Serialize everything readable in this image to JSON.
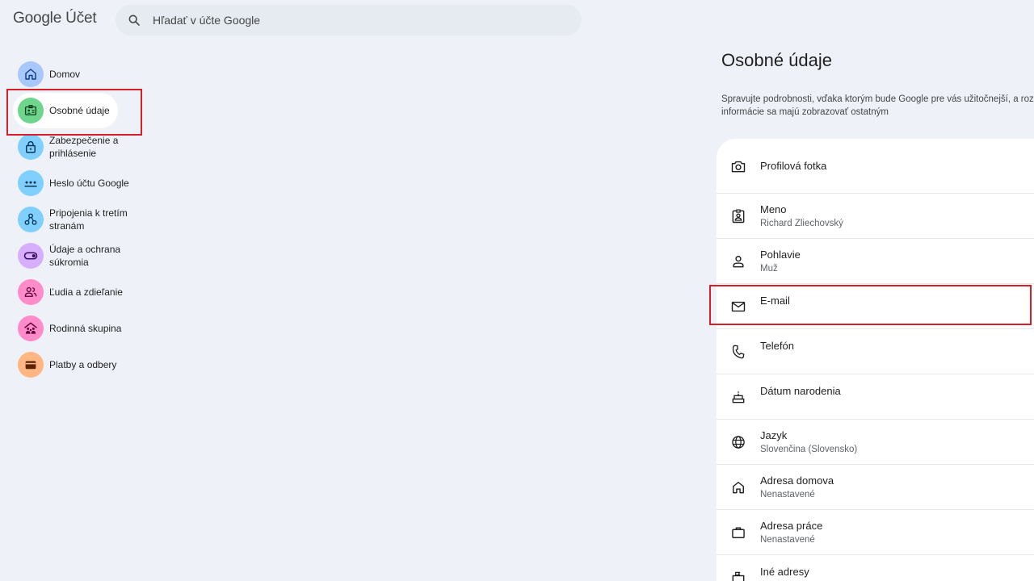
{
  "header": {
    "logo_google": "Google",
    "logo_product": "Účet",
    "search_placeholder": "Hľadať v účte Google"
  },
  "sidebar": {
    "items": [
      {
        "label": "Domov",
        "icon": "home-icon",
        "color": "#a8c7fa"
      },
      {
        "label": "Osobné údaje",
        "icon": "id-card-icon",
        "color": "#6dd58c",
        "active": true
      },
      {
        "label": "Zabezpečenie a prihlásenie",
        "icon": "lock-icon",
        "color": "#7fcfff"
      },
      {
        "label": "Heslo účtu Google",
        "icon": "password-icon",
        "color": "#7fcfff"
      },
      {
        "label": "Pripojenia k tretím stranám",
        "icon": "connections-icon",
        "color": "#7fcfff"
      },
      {
        "label": "Údaje a ochrana súkromia",
        "icon": "toggle-icon",
        "color": "#d7aefb"
      },
      {
        "label": "Ľudia a zdieľanie",
        "icon": "people-icon",
        "color": "#ff8bcb"
      },
      {
        "label": "Rodinná skupina",
        "icon": "family-icon",
        "color": "#ff8bcb"
      },
      {
        "label": "Platby a odbery",
        "icon": "wallet-icon",
        "color": "#ffb683"
      }
    ]
  },
  "main": {
    "title": "Osobné údaje",
    "description_line1": "Spravujte podrobnosti, vďaka ktorým bude Google pre vás užitočnejší, a rozh",
    "description_line2": "informácie sa majú zobrazovať ostatným",
    "rows": [
      {
        "label": "Profilová fotka",
        "value": "",
        "icon": "camera-icon"
      },
      {
        "label": "Meno",
        "value": "Richard Zliechovský",
        "icon": "badge-icon"
      },
      {
        "label": "Pohlavie",
        "value": "Muž",
        "icon": "person-icon"
      },
      {
        "label": "E-mail",
        "value": "",
        "icon": "mail-icon"
      },
      {
        "label": "Telefón",
        "value": "",
        "icon": "phone-icon"
      },
      {
        "label": "Dátum narodenia",
        "value": "",
        "icon": "cake-icon"
      },
      {
        "label": "Jazyk",
        "value": "Slovenčina (Slovensko)",
        "icon": "globe-icon"
      },
      {
        "label": "Adresa domova",
        "value": "Nenastavené",
        "icon": "home-icon"
      },
      {
        "label": "Adresa práce",
        "value": "Nenastavené",
        "icon": "briefcase-icon"
      },
      {
        "label": "Iné adresy",
        "value": "",
        "icon": "location-icon"
      }
    ]
  },
  "colors": {
    "background": "#eef2f8",
    "highlight": "#d81f26"
  }
}
